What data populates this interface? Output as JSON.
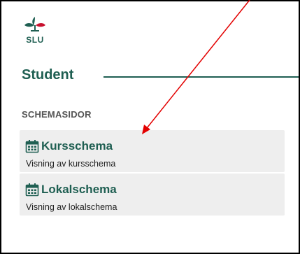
{
  "logo": {
    "text": "SLU"
  },
  "student": {
    "heading": "Student"
  },
  "section": {
    "label": "SCHEMASIDOR"
  },
  "schedule_items": [
    {
      "title": "Kursschema",
      "subtitle": "Visning av kursschema",
      "icon": "calendar-icon"
    },
    {
      "title": "Lokalschema",
      "subtitle": "Visning av lokalschema",
      "icon": "calendar-icon"
    }
  ],
  "colors": {
    "brand": "#1f5f52",
    "item_background": "#eeeeee",
    "annotation_arrow": "#e30000"
  }
}
